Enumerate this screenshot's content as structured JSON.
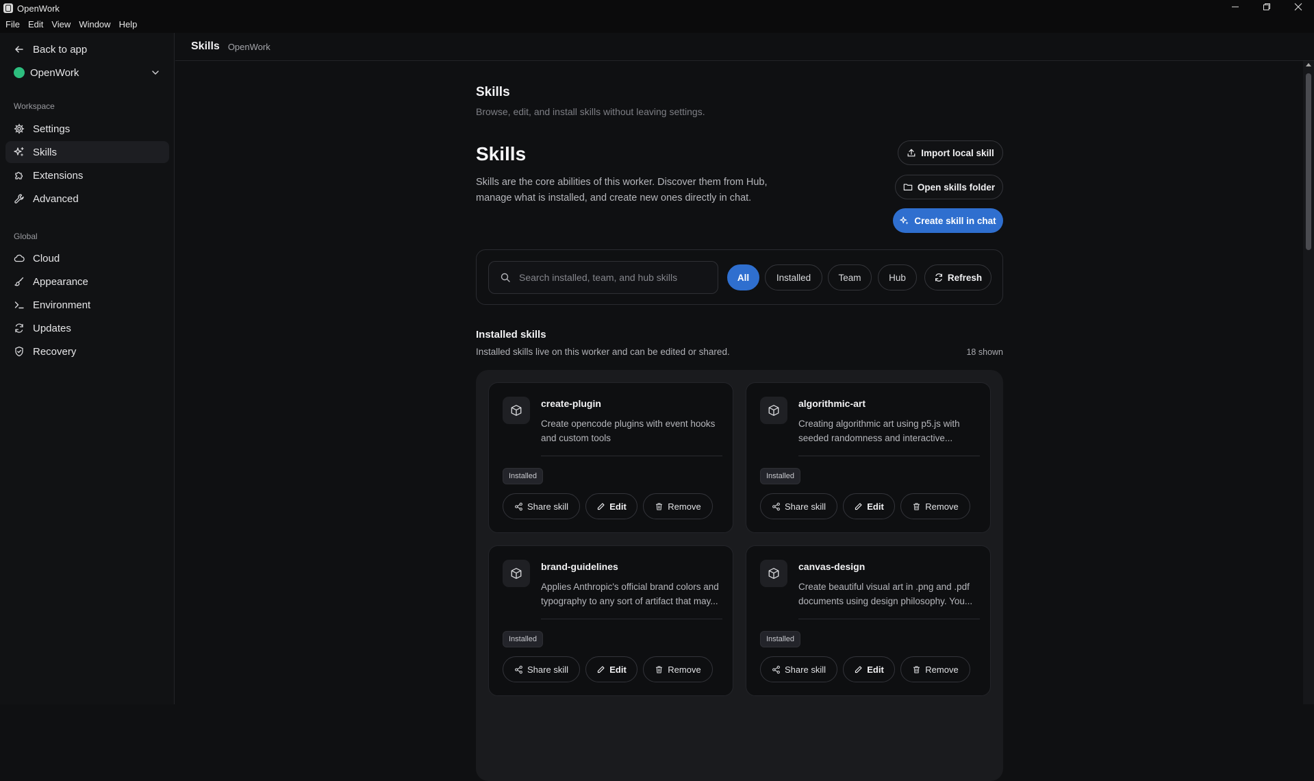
{
  "window": {
    "title": "OpenWork"
  },
  "menu": [
    "File",
    "Edit",
    "View",
    "Window",
    "Help"
  ],
  "sidebar": {
    "back_label": "Back to app",
    "workspace_name": "OpenWork",
    "workspace_color": "#2dbd7e",
    "workspace_section": "Workspace",
    "workspace_items": [
      {
        "label": "Settings",
        "icon": "gear-icon"
      },
      {
        "label": "Skills",
        "icon": "sparkles-icon",
        "active": true
      },
      {
        "label": "Extensions",
        "icon": "puzzle-icon"
      },
      {
        "label": "Advanced",
        "icon": "wrench-icon"
      }
    ],
    "global_section": "Global",
    "global_items": [
      {
        "label": "Cloud",
        "icon": "cloud-icon"
      },
      {
        "label": "Appearance",
        "icon": "paintbrush-icon"
      },
      {
        "label": "Environment",
        "icon": "terminal-icon"
      },
      {
        "label": "Updates",
        "icon": "refresh-icon"
      },
      {
        "label": "Recovery",
        "icon": "shield-icon"
      }
    ]
  },
  "topbar": {
    "title": "Skills",
    "subtitle": "OpenWork"
  },
  "page": {
    "title": "Skills",
    "subtitle": "Browse, edit, and install skills without leaving settings.",
    "heading": "Skills",
    "description": "Skills are the core abilities of this worker. Discover them from Hub, manage what is installed, and create new ones directly in chat.",
    "import_label": "Import local skill",
    "open_folder_label": "Open skills folder",
    "create_label": "Create skill in chat",
    "accent_color": "#2f6fcf"
  },
  "filters": {
    "search_placeholder": "Search installed, team, and hub skills",
    "search_value": "",
    "chips": [
      "All",
      "Installed",
      "Team",
      "Hub"
    ],
    "active_chip": "All",
    "refresh_label": "Refresh"
  },
  "installed": {
    "title": "Installed skills",
    "subtitle": "Installed skills live on this worker and can be edited or shared.",
    "count": "18 shown",
    "cards": [
      {
        "name": "create-plugin",
        "description": "Create opencode plugins with event hooks and custom tools",
        "badge": "Installed",
        "share": "Share skill",
        "edit": "Edit",
        "remove": "Remove"
      },
      {
        "name": "algorithmic-art",
        "description": "Creating algorithmic art using p5.js with seeded randomness and interactive...",
        "badge": "Installed",
        "share": "Share skill",
        "edit": "Edit",
        "remove": "Remove"
      },
      {
        "name": "brand-guidelines",
        "description": "Applies Anthropic's official brand colors and typography to any sort of artifact that may...",
        "badge": "Installed",
        "share": "Share skill",
        "edit": "Edit",
        "remove": "Remove"
      },
      {
        "name": "canvas-design",
        "description": "Create beautiful visual art in .png and .pdf documents using design philosophy. You...",
        "badge": "Installed",
        "share": "Share skill",
        "edit": "Edit",
        "remove": "Remove"
      }
    ]
  }
}
